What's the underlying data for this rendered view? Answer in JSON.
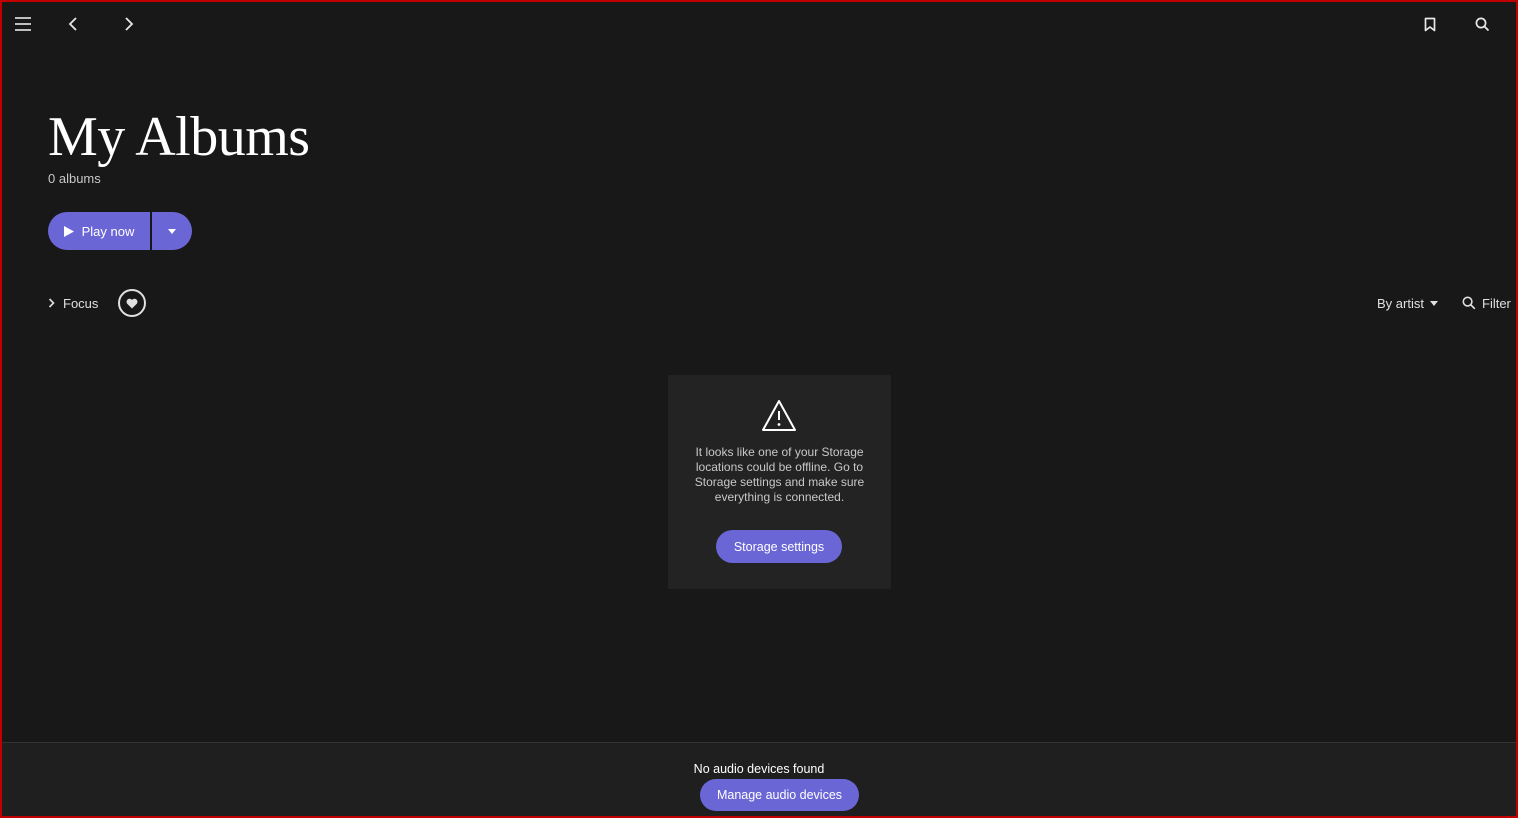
{
  "header": {
    "icons": {
      "menu": "hamburger-menu-icon",
      "back": "chevron-left-icon",
      "forward": "chevron-right-icon",
      "bookmark": "bookmark-icon",
      "search": "search-icon"
    }
  },
  "page": {
    "title": "My Albums",
    "count_label": "0 albums"
  },
  "actions": {
    "play_now_label": "Play now"
  },
  "toolbar": {
    "focus_label": "Focus",
    "sort_label": "By artist",
    "filter_label": "Filter"
  },
  "empty_state": {
    "message": "It looks like one of your Storage locations could be offline. Go to Storage settings and make sure everything is connected.",
    "button_label": "Storage settings"
  },
  "bottom_bar": {
    "status": "No audio devices found",
    "button_label": "Manage audio devices"
  },
  "colors": {
    "background": "#181818",
    "accent": "#6b66d6",
    "card": "#232323",
    "window_border": "#c00000"
  }
}
